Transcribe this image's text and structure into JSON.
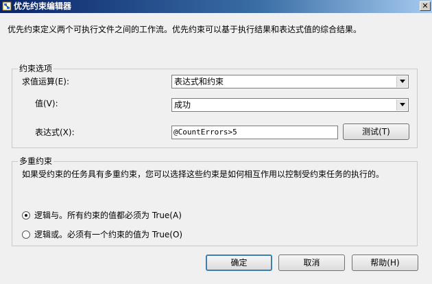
{
  "window": {
    "title": "优先约束编辑器",
    "close_glyph": "✕"
  },
  "description": "优先约束定义两个可执行文件之间的工作流。优先约束可以基于执行结果和表达式值的综合结果。",
  "constraint_options": {
    "legend": "约束选项",
    "evaluation": {
      "label": "求值运算(E):",
      "value": "表达式和约束"
    },
    "value": {
      "label": "值(V):",
      "value": "成功"
    },
    "expression": {
      "label": "表达式(X):",
      "value": "@CountErrors>5"
    },
    "test_button": "测试(T)"
  },
  "multiple_constraints": {
    "legend": "多重约束",
    "description": "如果受约束的任务具有多重约束，您可以选择这些约束是如何相互作用以控制受约束任务的执行的。",
    "options": [
      {
        "label": "逻辑与。所有约束的值都必须为 True(A)",
        "checked": true
      },
      {
        "label": "逻辑或。必须有一个约束的值为 True(O)",
        "checked": false
      }
    ]
  },
  "buttons": {
    "ok": "确定",
    "cancel": "取消",
    "help": "帮助(H)"
  }
}
